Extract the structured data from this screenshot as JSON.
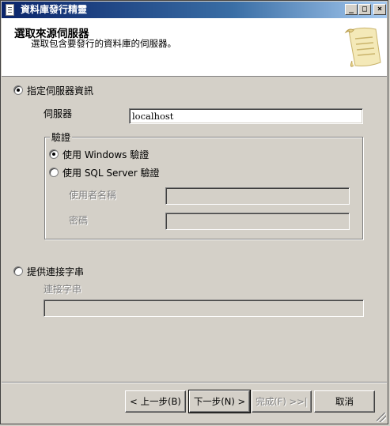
{
  "window": {
    "title": "資料庫發行精靈",
    "controls": {
      "minimize": "_",
      "maximize": "□",
      "close": "×"
    }
  },
  "header": {
    "title": "選取來源伺服器",
    "subtitle": "選取包含要發行的資料庫的伺服器。",
    "icon": "scroll-icon"
  },
  "server_option": {
    "label": "指定伺服器資訊",
    "checked": true,
    "server_label": "伺服器",
    "server_value": "localhost",
    "auth": {
      "legend": "驗證",
      "windows_label": "使用 Windows 驗證",
      "windows_checked": true,
      "sql_label": "使用 SQL Server 驗證",
      "sql_checked": false,
      "username_label": "使用者名稱",
      "username_value": "",
      "password_label": "密碼",
      "password_value": ""
    }
  },
  "connection_option": {
    "label": "提供連接字串",
    "checked": false,
    "connstr_label": "連接字串",
    "connstr_value": ""
  },
  "buttons": {
    "back": "< 上一步(B)",
    "next": "下一步(N) >",
    "finish": "完成(F) >>|",
    "cancel": "取消"
  }
}
